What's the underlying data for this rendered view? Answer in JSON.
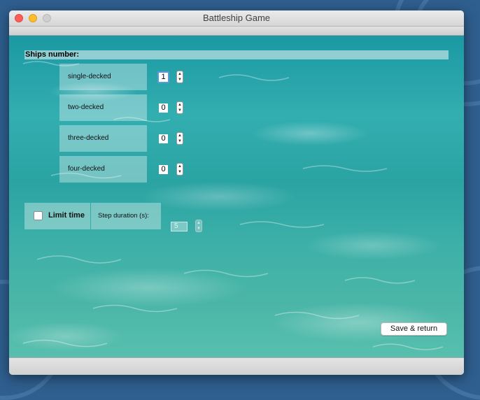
{
  "window": {
    "title": "Battleship Game"
  },
  "ships": {
    "header": "Ships number:",
    "rows": [
      {
        "label": "single-decked",
        "count": "1"
      },
      {
        "label": "two-decked",
        "count": "0"
      },
      {
        "label": "three-decked",
        "count": "0"
      },
      {
        "label": "four-decked",
        "count": "0"
      }
    ]
  },
  "time": {
    "limit_label": "Limit time",
    "limit_checked": false,
    "step_label": "Step duration (s):",
    "step_value": "5"
  },
  "actions": {
    "save_label": "Save & return"
  },
  "icons": {
    "close": "close-icon",
    "minimize": "minimize-icon",
    "zoom": "zoom-icon",
    "stepper_up": "chevron-up-icon",
    "stepper_down": "chevron-down-icon",
    "checkbox": "checkbox-icon"
  },
  "colors": {
    "close": "#fc5f57",
    "minimize": "#fdbb2e",
    "zoom": "#cfcfcf",
    "water": "#2aa3a3"
  }
}
